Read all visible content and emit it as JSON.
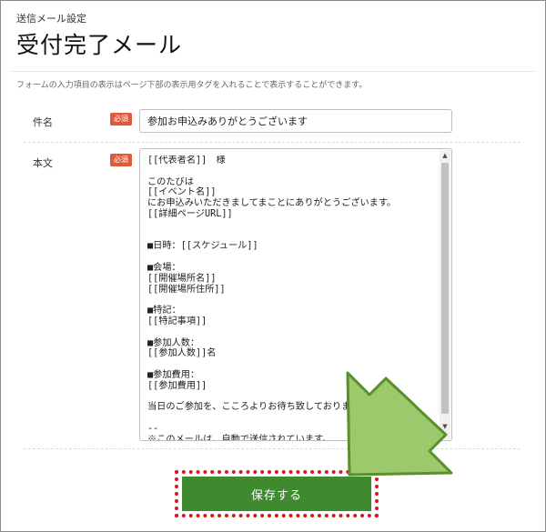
{
  "breadcrumb": "送信メール設定",
  "title": "受付完了メール",
  "description": "フォームの入力項目の表示はページ下部の表示用タグを入れることで表示することができます。",
  "subject": {
    "label": "件名",
    "required": "必須",
    "value": "参加お申込みありがとうございます"
  },
  "body": {
    "label": "本文",
    "required": "必須",
    "text": "[[代表者名]]　様\n\nこのたびは\n[[イベント名]]\nにお申込みいただきましてまことにありがとうございます。\n[[詳細ページURL]]\n\n\n■日時：[[スケジュール]]\n\n■会場：\n[[開催場所名]]\n[[開催場所住所]]\n\n■特記：\n[[特記事項]]\n\n■参加人数：\n[[参加人数]]名\n\n■参加費用：\n[[参加費用]]\n\n当日のご参加を、こころよりお待ち致しております。\n\n--\n※このメールは、自動で送信されています。"
  },
  "scrollbar": {
    "up_icon": "▲",
    "down_icon": "▼"
  },
  "save_button": "保存する",
  "colors": {
    "required_badge": "#e05a3a",
    "save_button": "#3f8a2e",
    "highlight_border": "#d1191f",
    "arrow_fill": "#9cc96b",
    "arrow_outline": "#5b8f2c"
  }
}
